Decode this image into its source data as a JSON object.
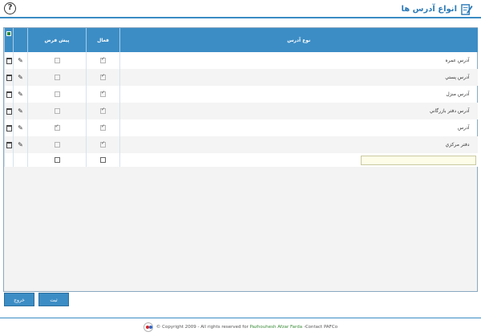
{
  "header": {
    "title": "انواع آدرس ها",
    "help_symbol": "?",
    "icons": {
      "help": "help-icon",
      "title": "edit-document-icon"
    }
  },
  "grid": {
    "columns": {
      "type": "نوع آدرس",
      "active": "فعال",
      "default": "پیش فرض"
    },
    "rows": [
      {
        "type": "آدرس عمره",
        "active": true,
        "default": false
      },
      {
        "type": "آدرس پستي",
        "active": true,
        "default": false
      },
      {
        "type": "آدرس منزل",
        "active": true,
        "default": false
      },
      {
        "type": "آدرس دفتر بازرگاني",
        "active": true,
        "default": false
      },
      {
        "type": "آدرس",
        "active": true,
        "default": true
      },
      {
        "type": "دفتر مرکزي",
        "active": true,
        "default": false
      }
    ],
    "new_row": {
      "type": "",
      "active": false,
      "default": false
    },
    "row_icons": {
      "delete": "trash-icon",
      "edit": "pencil-icon"
    }
  },
  "buttons": {
    "save": "ثبت",
    "exit": "خروج"
  },
  "footer": {
    "copyright": "© Copyright 2009 - All rights reserved for",
    "company": "Pazhouhesh Afzar Farda",
    "contact": "-Contact PAFCo"
  },
  "colors": {
    "accent": "#3c8dc5",
    "title": "#2d7bb8",
    "grid_header": "#3c8dc5"
  }
}
